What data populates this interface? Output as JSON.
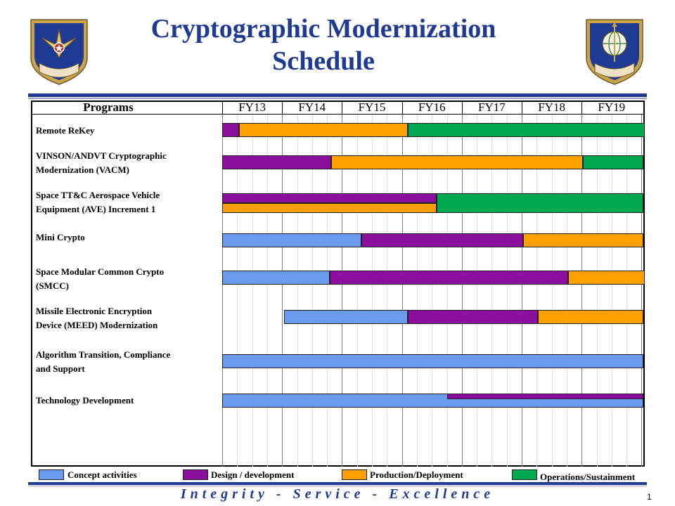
{
  "title_line1": "Cryptographic Modernization",
  "title_line2": "Schedule",
  "emblems": {
    "left": {
      "name": "air-force-materiel-command-shield",
      "text": "AIR FORCE MATERIEL COMMAND"
    },
    "right": {
      "name": "air-force-lcmc-shield",
      "text": "AIR FORCE LCMC"
    }
  },
  "colors": {
    "Concept activities": "#6b9bef",
    "Design / development": "#8b0e9e",
    "Production/Deployment": "#ffa000",
    "Operations/Sustainment": "#00a84f",
    "brand": "#1f3a93"
  },
  "chart_data": {
    "type": "gantt",
    "programs_header": "Programs",
    "fiscal_years": [
      "FY13",
      "FY14",
      "FY15",
      "FY16",
      "FY17",
      "FY18",
      "FY19"
    ],
    "phases": [
      "Concept activities",
      "Design / development",
      "Production/Deployment",
      "Operations/Sustainment"
    ],
    "programs": [
      {
        "lines": [
          "Remote ReKey"
        ],
        "bars": [
          {
            "start": 2013.0,
            "end": 2013.28,
            "phase": "Design / development"
          },
          {
            "start": 2013.28,
            "end": 2016.1,
            "phase": "Production/Deployment"
          },
          {
            "start": 2016.1,
            "end": 2020.05,
            "phase": "Operations/Sustainment"
          }
        ]
      },
      {
        "lines": [
          "VINSON/ANDVT Cryptographic",
          "Modernization  (VACM)"
        ],
        "bars": [
          {
            "start": 2013.0,
            "end": 2014.82,
            "phase": "Design / development"
          },
          {
            "start": 2014.82,
            "end": 2019.02,
            "phase": "Production/Deployment"
          },
          {
            "start": 2019.02,
            "end": 2020.03,
            "phase": "Operations/Sustainment"
          }
        ]
      },
      {
        "lines": [
          "Space TT&C Aerospace Vehicle",
          "Equipment  (AVE)  Increment  1"
        ],
        "bars": [
          {
            "start": 2013.0,
            "end": 2016.58,
            "phase": "Design / development",
            "lane": "top"
          },
          {
            "start": 2013.0,
            "end": 2016.58,
            "phase": "Production/Deployment",
            "lane": "bottom"
          },
          {
            "start": 2016.58,
            "end": 2020.03,
            "phase": "Operations/Sustainment"
          }
        ]
      },
      {
        "lines": [
          "Mini Crypto"
        ],
        "bars": [
          {
            "start": 2013.0,
            "end": 2015.32,
            "phase": "Concept activities"
          },
          {
            "start": 2015.32,
            "end": 2018.02,
            "phase": "Design / development"
          },
          {
            "start": 2018.02,
            "end": 2020.03,
            "phase": "Production/Deployment"
          }
        ]
      },
      {
        "lines": [
          "Space Modular Common  Crypto",
          "(SMCC)"
        ],
        "bars": [
          {
            "start": 2013.0,
            "end": 2014.8,
            "phase": "Concept activities"
          },
          {
            "start": 2014.8,
            "end": 2018.78,
            "phase": "Design / development"
          },
          {
            "start": 2018.78,
            "end": 2020.05,
            "phase": "Production/Deployment"
          }
        ]
      },
      {
        "lines": [
          "Missile Electronic Encryption",
          "Device (MEED) Modernization"
        ],
        "bars": [
          {
            "start": 2014.03,
            "end": 2016.1,
            "phase": "Concept activities"
          },
          {
            "start": 2016.1,
            "end": 2018.27,
            "phase": "Design / development"
          },
          {
            "start": 2018.27,
            "end": 2020.03,
            "phase": "Production/Deployment"
          }
        ]
      },
      {
        "lines": [
          "Algorithm  Transition,  Compliance",
          "and Support"
        ],
        "bars": [
          {
            "start": 2013.0,
            "end": 2020.03,
            "phase": "Concept activities"
          }
        ]
      },
      {
        "lines": [
          "Technology  Development"
        ],
        "bars": [
          {
            "start": 2013.0,
            "end": 2020.03,
            "phase": "Concept activities"
          },
          {
            "start": 2016.75,
            "end": 2020.03,
            "phase": "Design / development",
            "lane": "overlay"
          }
        ]
      }
    ]
  },
  "legend": [
    {
      "label": "Concept activities",
      "color": "#6b9bef"
    },
    {
      "label": "Design / development",
      "color": "#8b0e9e"
    },
    {
      "label": "Production/Deployment",
      "color": "#ffa000"
    },
    {
      "label": "Operations/Sustainment",
      "color": "#00a84f"
    }
  ],
  "footer": {
    "motto": "Integrity - Service - Excellence",
    "page": "1"
  }
}
